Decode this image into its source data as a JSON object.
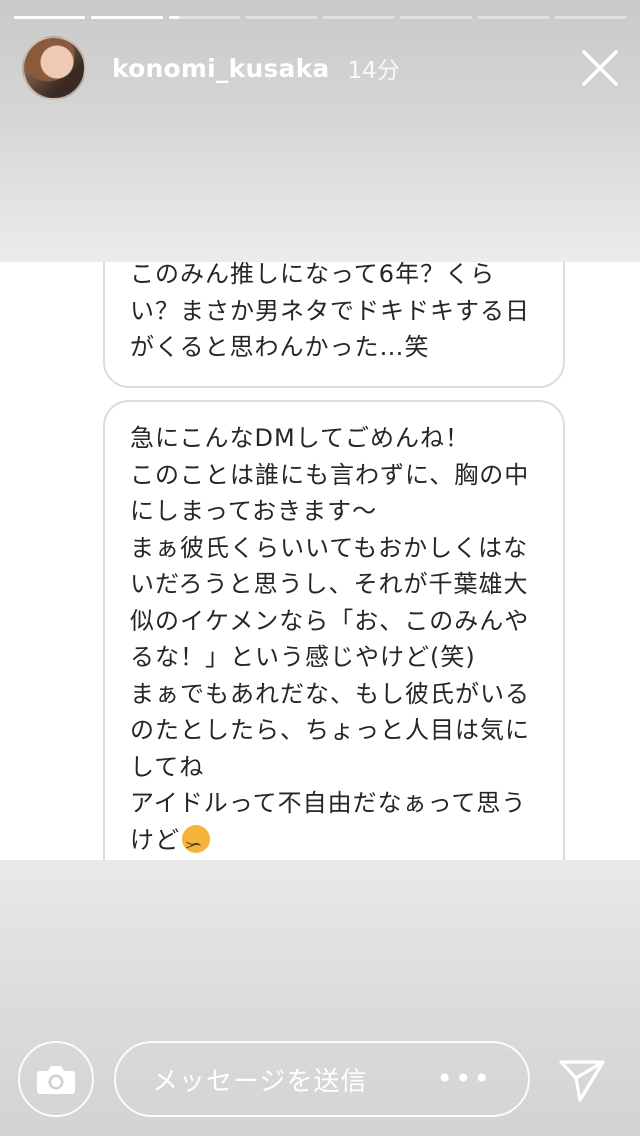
{
  "story": {
    "progress": [
      1,
      1,
      0.15,
      0,
      0,
      0,
      0,
      0
    ],
    "user": {
      "username": "konomi_kusaka",
      "time": "14分"
    }
  },
  "messages": [
    {
      "lines": [
        "このみん推しになって6年？くら",
        "い？まさか男ネタでドキドキする日",
        "がくると思わんかった…笑"
      ]
    },
    {
      "lines": [
        "急にこんなDMしてごめんね！",
        "このことは誰にも言わずに、胸の中",
        "にしまっておきます〜",
        "まぁ彼氏くらいいてもおかしくはな",
        "いだろうと思うし、それが千葉雄大",
        "似のイケメンなら「お、このみんや",
        "るな！」という感じやけど(笑)",
        "まぁでもあれだな、もし彼氏がいる",
        "のたとしたら、ちょっと人目は気に",
        "してね",
        "アイドルって不自由だなぁって思う",
        "けど"
      ],
      "emoji": "confounded-face-emoji"
    }
  ],
  "footer": {
    "placeholder": "メッセージを送信",
    "more": "•••",
    "camera_icon": "camera-icon",
    "send_icon": "send-icon"
  }
}
